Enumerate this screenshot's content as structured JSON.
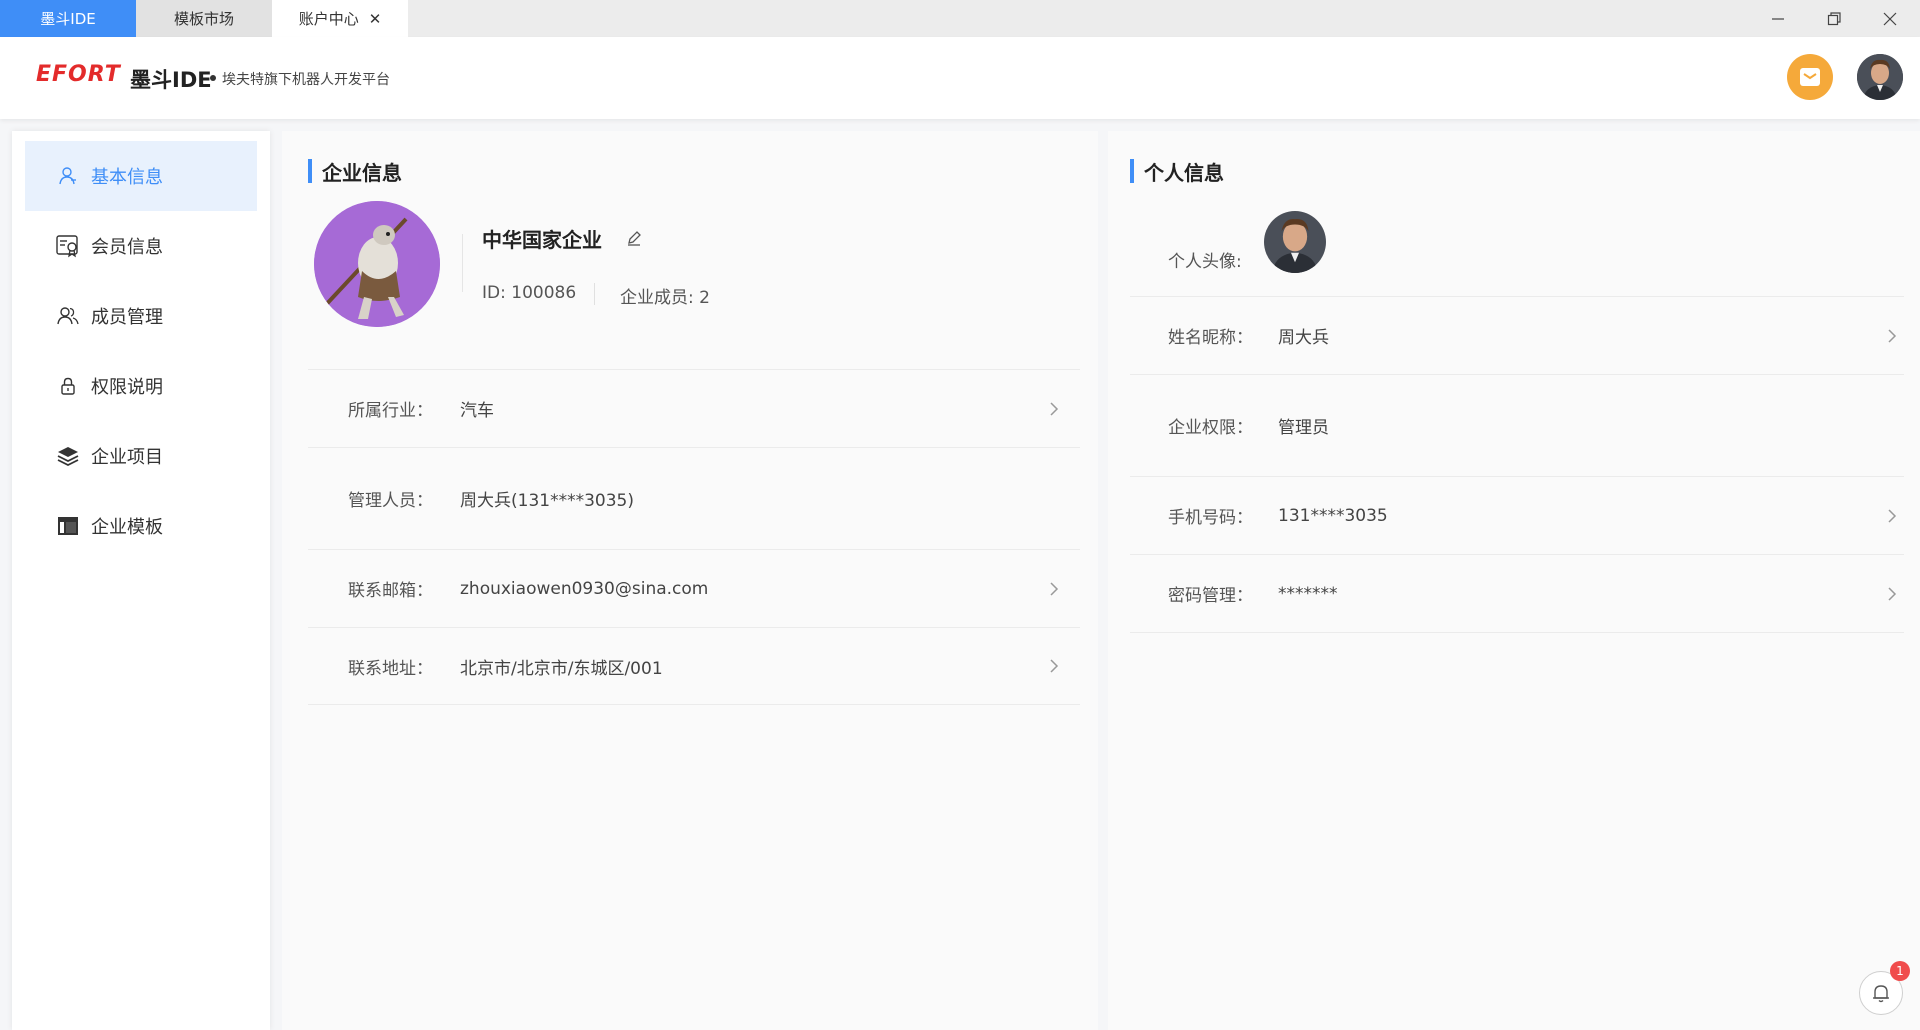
{
  "tabs": [
    {
      "label": "墨斗IDE"
    },
    {
      "label": "模板市场"
    },
    {
      "label": "账户中心"
    }
  ],
  "header": {
    "brand": "EFORT",
    "product": "墨斗IDE",
    "subtitle": "埃夫特旗下机器人开发平台"
  },
  "sidebar": {
    "items": [
      {
        "label": "基本信息",
        "icon": "user-icon"
      },
      {
        "label": "会员信息",
        "icon": "certificate-icon"
      },
      {
        "label": "成员管理",
        "icon": "members-icon"
      },
      {
        "label": "权限说明",
        "icon": "lock-icon"
      },
      {
        "label": "企业项目",
        "icon": "layers-icon"
      },
      {
        "label": "企业模板",
        "icon": "template-icon"
      }
    ]
  },
  "enterprise": {
    "title": "企业信息",
    "name": "中华国家企业",
    "id_label": "ID:",
    "id_value": "100086",
    "members_label": "企业成员:",
    "members_value": "2",
    "rows": [
      {
        "label": "所属行业：",
        "value": "汽车"
      },
      {
        "label": "管理人员：",
        "value": "周大兵(131****3035)"
      },
      {
        "label": "联系邮箱：",
        "value": "zhouxiaowen0930@sina.com"
      },
      {
        "label": "联系地址：",
        "value": "北京市/北京市/东城区/001"
      }
    ]
  },
  "personal": {
    "title": "个人信息",
    "avatar_label": "个人头像:",
    "rows": [
      {
        "label": "姓名昵称：",
        "value": "周大兵"
      },
      {
        "label": "企业权限：",
        "value": "管理员"
      },
      {
        "label": "手机号码：",
        "value": "131****3035"
      },
      {
        "label": "密码管理：",
        "value": "*******"
      }
    ]
  },
  "notifications": {
    "count": "1"
  },
  "colors": {
    "accent": "#3f8ef7",
    "mail": "#f5a93a",
    "badge": "#f04c4c",
    "enterprise_avatar": "#a66ad6"
  }
}
